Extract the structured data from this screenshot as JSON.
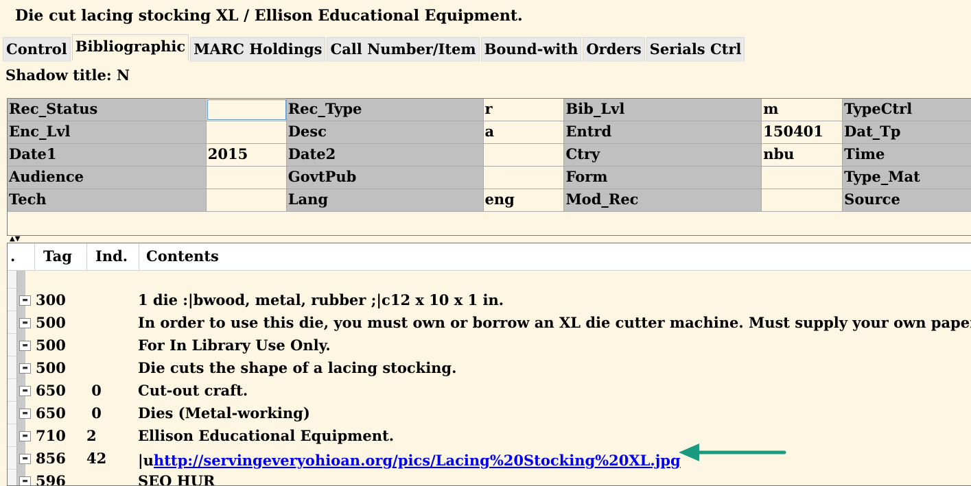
{
  "record": {
    "title": "Die cut lacing stocking XL / Ellison Educational Equipment."
  },
  "tabs": [
    {
      "label": "Control",
      "active": false
    },
    {
      "label": "Bibliographic",
      "active": true
    },
    {
      "label": "MARC Holdings",
      "active": false
    },
    {
      "label": "Call Number/Item",
      "active": false
    },
    {
      "label": "Bound-with",
      "active": false
    },
    {
      "label": "Orders",
      "active": false
    },
    {
      "label": "Serials Ctrl",
      "active": false
    }
  ],
  "shadow_title": "Shadow title: N",
  "fixed_fields": [
    [
      {
        "label": "Rec_Status",
        "value": ""
      },
      {
        "label": "Rec_Type",
        "value": "r"
      },
      {
        "label": "Bib_Lvl",
        "value": "m"
      },
      {
        "label": "TypeCtrl",
        "value": ""
      }
    ],
    [
      {
        "label": "Enc_Lvl",
        "value": ""
      },
      {
        "label": "Desc",
        "value": "a"
      },
      {
        "label": "Entrd",
        "value": "150401"
      },
      {
        "label": "Dat_Tp",
        "value": ""
      }
    ],
    [
      {
        "label": "Date1",
        "value": "2015"
      },
      {
        "label": "Date2",
        "value": ""
      },
      {
        "label": "Ctry",
        "value": "nbu"
      },
      {
        "label": "Time",
        "value": ""
      }
    ],
    [
      {
        "label": "Audience",
        "value": ""
      },
      {
        "label": "GovtPub",
        "value": ""
      },
      {
        "label": "Form",
        "value": ""
      },
      {
        "label": "Type_Mat",
        "value": ""
      }
    ],
    [
      {
        "label": "Tech",
        "value": ""
      },
      {
        "label": "Lang",
        "value": "eng"
      },
      {
        "label": "Mod_Rec",
        "value": ""
      },
      {
        "label": "Source",
        "value": ""
      }
    ]
  ],
  "var_grid": {
    "headers": {
      "dot": ".",
      "tag": "Tag",
      "ind": "Ind.",
      "contents": "Contents"
    },
    "rows": [
      {
        "tag": "300",
        "ind": "",
        "contents": "1 die :|bwood, metal, rubber ;|c12 x 10 x 1 in."
      },
      {
        "tag": "500",
        "ind": "",
        "contents": "In order to use this die, you must own or borrow an XL die cutter machine. Must supply your own paper."
      },
      {
        "tag": "500",
        "ind": "",
        "contents": "For In Library Use Only."
      },
      {
        "tag": "500",
        "ind": "",
        "contents": "Die cuts the shape of a lacing stocking."
      },
      {
        "tag": "650",
        "ind": " 0",
        "contents": "Cut-out craft."
      },
      {
        "tag": "650",
        "ind": " 0",
        "contents": "Dies (Metal-working)"
      },
      {
        "tag": "710",
        "ind": "2",
        "contents": "Ellison Educational Equipment."
      },
      {
        "tag": "856",
        "ind": "42",
        "contents_prefix": "|u",
        "link": "http://servingeveryohioan.org/pics/Lacing%20Stocking%20XL.jpg"
      },
      {
        "tag": "596",
        "ind": "",
        "contents": "SEO HUR"
      }
    ]
  },
  "colors": {
    "background": "#fdf6e3",
    "label_gray": "#c0c0c0",
    "link": "#0000ee",
    "arrow": "#1a9a7e"
  }
}
